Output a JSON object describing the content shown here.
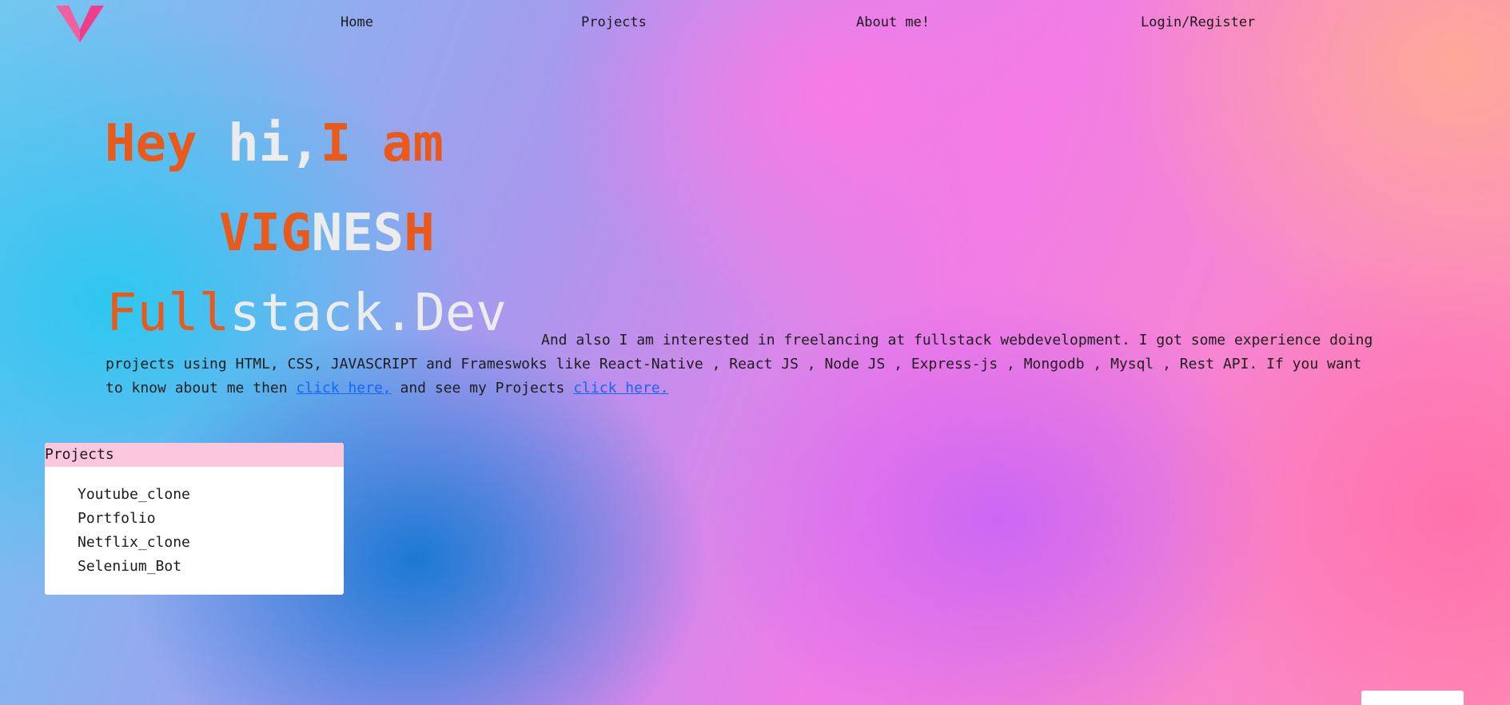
{
  "nav": {
    "home": "Home",
    "projects": "Projects",
    "about": "About me!",
    "login": "Login/Register"
  },
  "hero": {
    "greeting_a": "Hey ",
    "greeting_b": "hi,",
    "greeting_c": "I am",
    "name_a": "VIG",
    "name_b": "NES",
    "name_c": "H",
    "role_a": "Full",
    "role_b": "stack.De",
    "role_c": "v"
  },
  "intro": {
    "text_1": "And also I am interested in freelancing at fullstack webdevelopment. I got some experience doing projects using HTML, CSS, JAVASCRIPT and Frameswoks like React-Native , React JS , Node JS , Express-js , Mongodb , Mysql , Rest API. If you want to know about me then ",
    "link_1": "click here,",
    "text_2": " and see my Projects ",
    "link_2": "click here."
  },
  "projects_card": {
    "title": "Projects",
    "items": [
      "Youtube_clone",
      "Portfolio",
      "Netflix_clone",
      "Selenium_Bot"
    ]
  },
  "colors": {
    "accent_orange": "#e8591a",
    "link_blue": "#1864ff",
    "card_header_pink": "#fcc6dc",
    "logo_pink": "#ef3d8b"
  },
  "icons": {
    "logo": "v-logo-icon"
  }
}
